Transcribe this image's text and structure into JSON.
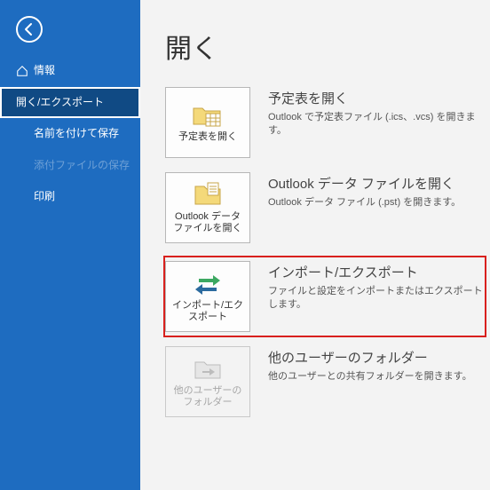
{
  "sidebar": {
    "items": [
      {
        "label": "情報",
        "icon": "home"
      },
      {
        "label": "開く/エクスポート",
        "selected": true
      },
      {
        "label": "名前を付けて保存"
      },
      {
        "label": "添付ファイルの保存",
        "disabled": true
      },
      {
        "label": "印刷"
      }
    ]
  },
  "main": {
    "title": "開く",
    "options": [
      {
        "button_label": "予定表を開く",
        "title": "予定表を開く",
        "desc": "Outlook で予定表ファイル (.ics、.vcs) を開きます。",
        "icon": "calendar"
      },
      {
        "button_label": "Outlook データ ファイルを開く",
        "title": "Outlook データ ファイルを開く",
        "desc": "Outlook データ ファイル (.pst) を開きます。",
        "icon": "folder"
      },
      {
        "button_label": "インポート/エクスポート",
        "title": "インポート/エクスポート",
        "desc": "ファイルと設定をインポートまたはエクスポートします。",
        "icon": "import-export",
        "highlighted": true
      },
      {
        "button_label": "他のユーザーのフォルダー",
        "title": "他のユーザーのフォルダー",
        "desc": "他のユーザーとの共有フォルダーを開きます。",
        "icon": "shared-folder",
        "disabled": true
      }
    ]
  }
}
